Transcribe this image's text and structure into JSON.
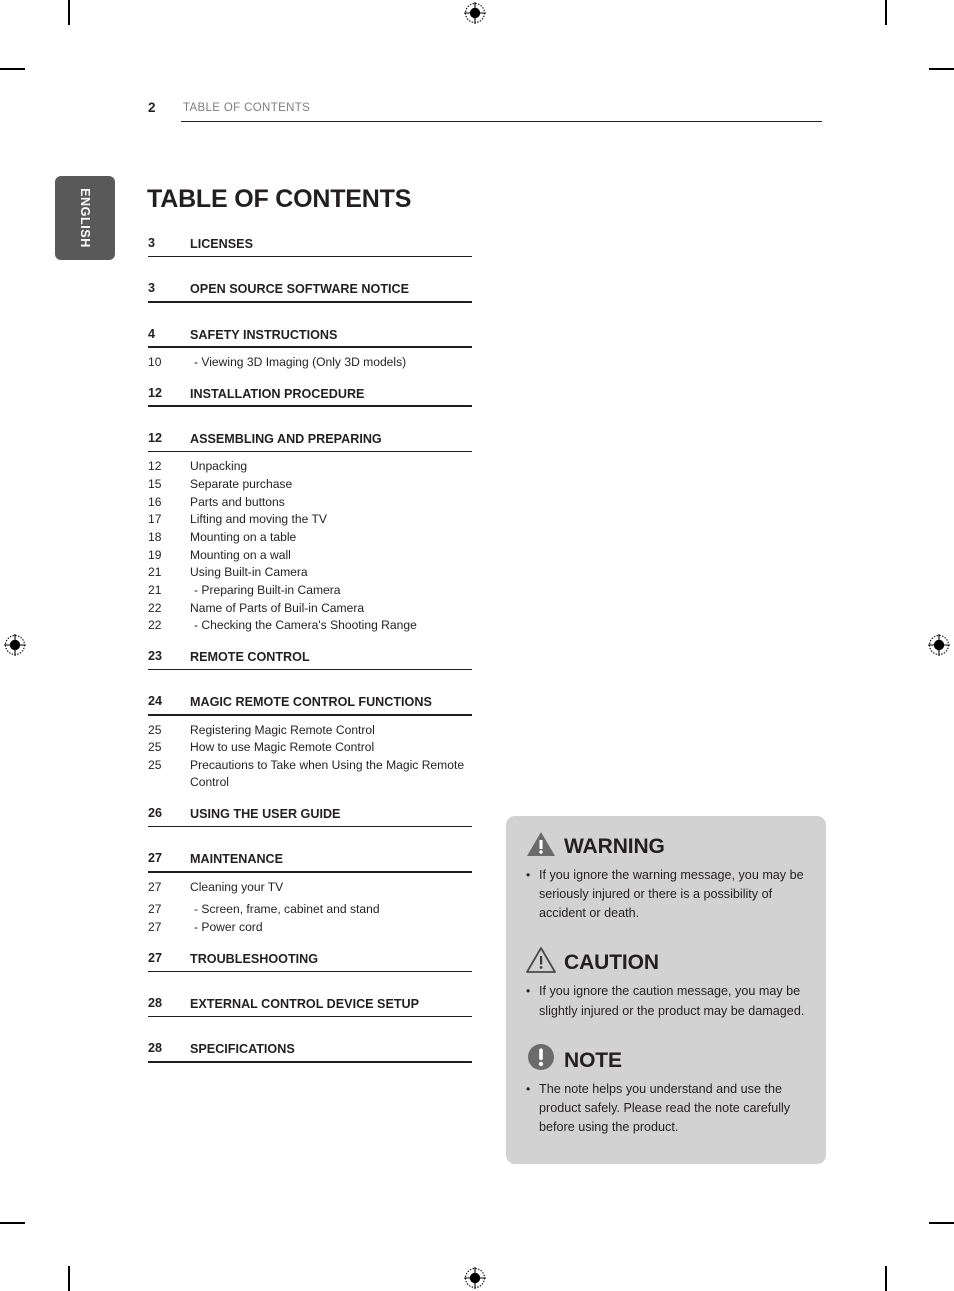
{
  "language_tab": {
    "label": "ENGLISH"
  },
  "header": {
    "page_number": "2",
    "title": "TABLE OF CONTENTS"
  },
  "page_title": "TABLE OF CONTENTS",
  "toc": {
    "sections": [
      {
        "page": "3",
        "label": "LICENSES",
        "items": []
      },
      {
        "page": "3",
        "label": "OPEN SOURCE SOFTWARE NOTICE",
        "items": []
      },
      {
        "page": "4",
        "label": "SAFETY INSTRUCTIONS",
        "items": [
          {
            "page": "10",
            "label": "-  Viewing 3D Imaging (Only 3D models)",
            "dash": true
          }
        ]
      },
      {
        "page": "12",
        "label": "INSTALLATION PROCEDURE",
        "items": []
      },
      {
        "page": "12",
        "label": "ASSEMBLING AND PREPARING",
        "items": [
          {
            "page": "12",
            "label": "Unpacking",
            "dash": false
          },
          {
            "page": "15",
            "label": "Separate purchase",
            "dash": false
          },
          {
            "page": "16",
            "label": "Parts and buttons",
            "dash": false
          },
          {
            "page": "17",
            "label": "Lifting and moving the TV",
            "dash": false
          },
          {
            "page": "18",
            "label": "Mounting on a table",
            "dash": false
          },
          {
            "page": "19",
            "label": "Mounting on a wall",
            "dash": false
          },
          {
            "page": "21",
            "label": "Using Built-in Camera",
            "dash": false
          },
          {
            "page": "21",
            "label": "- Preparing Built-in Camera",
            "dash": true
          },
          {
            "page": "22",
            "label": "Name of Parts of Buil-in Camera",
            "dash": false
          },
          {
            "page": "22",
            "label": "- Checking the Camera's Shooting Range",
            "dash": true
          }
        ]
      },
      {
        "page": "23",
        "label": "REMOTE CONTROL",
        "items": []
      },
      {
        "page": "24",
        "label": "MAGIC REMOTE CONTROL FUNCTIONS",
        "items": [
          {
            "page": "25",
            "label": "Registering Magic Remote Control",
            "dash": false
          },
          {
            "page": "25",
            "label": "How to use Magic Remote Control",
            "dash": false
          },
          {
            "page": "25",
            "label": "Precautions to Take when Using the Magic Remote Control",
            "dash": false
          }
        ]
      },
      {
        "page": "26",
        "label": "USING THE USER GUIDE",
        "items": []
      },
      {
        "page": "27",
        "label": "MAINTENANCE",
        "items": [
          {
            "page": "27",
            "label": "Cleaning your TV",
            "dash": false
          },
          {
            "page": "27",
            "label": "-  Screen, frame, cabinet and stand",
            "dash": true,
            "loose": true
          },
          {
            "page": "27",
            "label": "-  Power cord",
            "dash": true
          }
        ]
      },
      {
        "page": "27",
        "label": "TROUBLESHOOTING",
        "items": []
      },
      {
        "page": "28",
        "label": "EXTERNAL CONTROL DEVICE SETUP",
        "items": []
      },
      {
        "page": "28",
        "label": "SPECIFICATIONS",
        "items": []
      }
    ]
  },
  "notices": [
    {
      "icon": "warning-triangle-filled-icon",
      "word": "WARNING",
      "bullet": "•",
      "text": "If you ignore the warning message, you may be seriously injured or there is a possibility of accident or death."
    },
    {
      "icon": "caution-triangle-outline-icon",
      "word": "CAUTION",
      "bullet": "•",
      "text": "If you ignore the caution message, you may be slightly injured or the product may be damaged."
    },
    {
      "icon": "note-circle-icon",
      "word": "NOTE",
      "bullet": "•",
      "text": "The note helps you understand and use the product safely. Please read the note carefully before using the product."
    }
  ],
  "colors": {
    "ink": "#231f20",
    "header_gray": "#7d7d7d",
    "tab_gray": "#595959",
    "notice_bg": "#d2d2d2"
  }
}
